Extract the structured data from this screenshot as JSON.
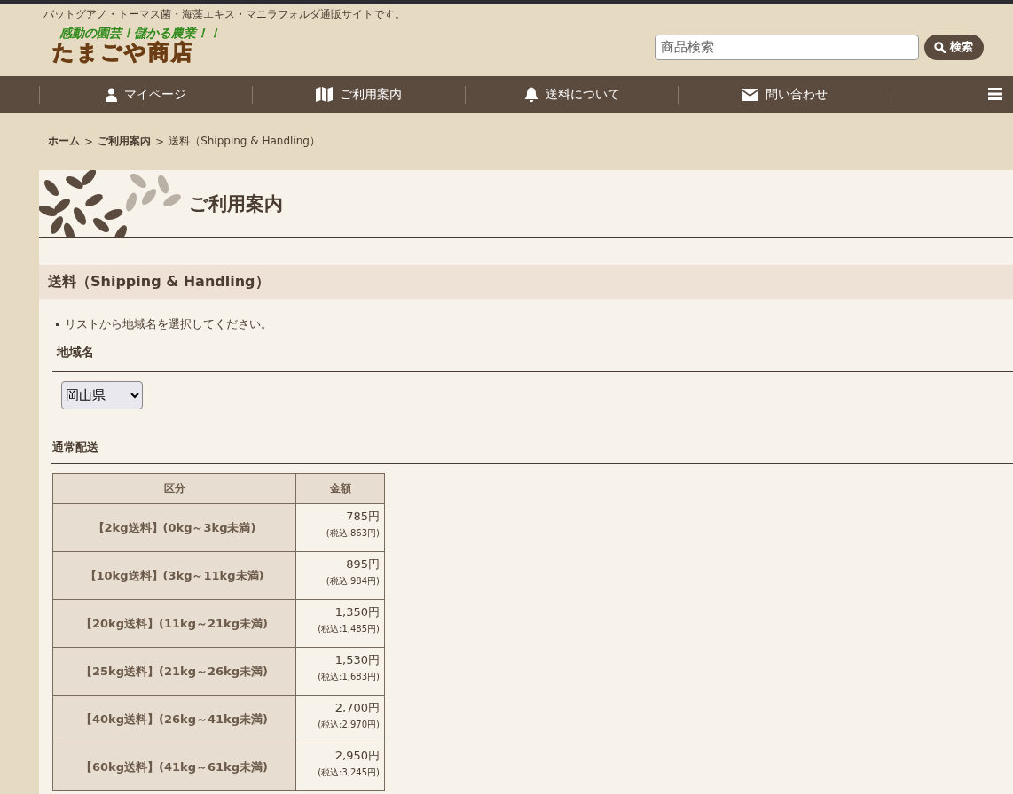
{
  "header": {
    "tagline": "バットグアノ・トーマス菌・海藻エキス・マニラフォルダ通販サイトです。",
    "logo": {
      "catchphrase": "感動の園芸！儲かる農業！！",
      "name": "たまごや商店"
    },
    "search": {
      "placeholder": "商品検索"
    },
    "search_button": "検索"
  },
  "nav": {
    "items": [
      {
        "label": "マイページ",
        "kind": "person"
      },
      {
        "label": "ご利用案内",
        "kind": "map"
      },
      {
        "label": "送料について",
        "kind": "bell"
      },
      {
        "label": "問い合わせ",
        "kind": "mail"
      }
    ]
  },
  "breadcrumb": {
    "separator": ">",
    "items": [
      {
        "label": "ホーム",
        "link": true
      },
      {
        "label": "ご利用案内",
        "link": true
      },
      {
        "label": "送料（Shipping & Handling）",
        "link": false
      }
    ]
  },
  "page_title": "ご利用案内",
  "section_title": "送料（Shipping & Handling）",
  "instruction": "リストから地域名を選択してください。",
  "region": {
    "label": "地域名",
    "value": "岡山県"
  },
  "subsection": "通常配送",
  "table": {
    "columns": [
      "区分",
      "金額"
    ],
    "rows": [
      {
        "category": "【2kg送料】(0kg～3kg未満)",
        "price": "785円",
        "tax_included": "(税込:863円)"
      },
      {
        "category": "【10kg送料】(3kg～11kg未満)",
        "price": "895円",
        "tax_included": "(税込:984円)"
      },
      {
        "category": "【20kg送料】(11kg～21kg未満)",
        "price": "1,350円",
        "tax_included": "(税込:1,485円)"
      },
      {
        "category": "【25kg送料】(21kg～26kg未満)",
        "price": "1,530円",
        "tax_included": "(税込:1,683円)"
      },
      {
        "category": "【40kg送料】(26kg～41kg未満)",
        "price": "2,700円",
        "tax_included": "(税込:2,970円)"
      },
      {
        "category": "【60kg送料】(41kg～61kg未満)",
        "price": "2,950円",
        "tax_included": "(税込:3,245円)"
      }
    ]
  }
}
